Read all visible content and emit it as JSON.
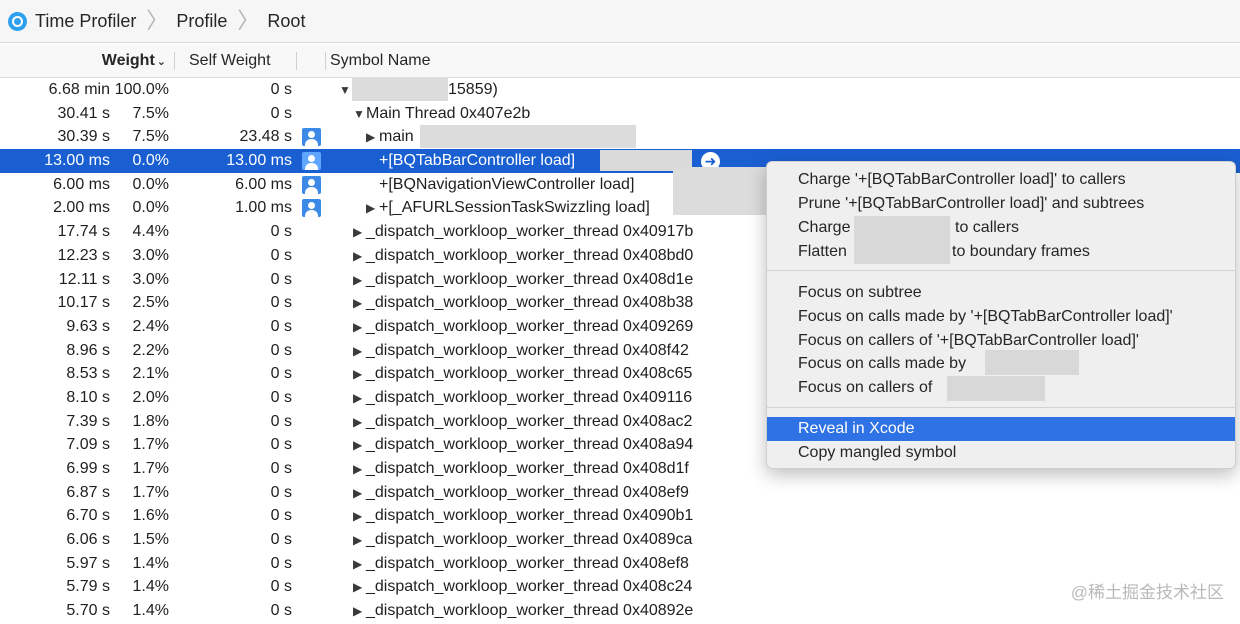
{
  "breadcrumb": {
    "items": [
      "Time Profiler",
      "Profile",
      "Root"
    ],
    "separator": "〉"
  },
  "columns": {
    "weight": "Weight",
    "self_weight": "Self Weight",
    "symbol_name": "Symbol Name",
    "sort_indicator": "⌄"
  },
  "rows": [
    {
      "weight": "6.68 min",
      "percent": "100.0%",
      "self": "0 s",
      "symbol": "15859)",
      "triangle": "▼"
    },
    {
      "weight": "30.41 s",
      "percent": "7.5%",
      "self": "0 s",
      "symbol": "Main Thread  0x407e2b",
      "triangle": "▼"
    },
    {
      "weight": "30.39 s",
      "percent": "7.5%",
      "self": "23.48 s",
      "symbol": "main",
      "triangle": "▶"
    },
    {
      "weight": "13.00 ms",
      "percent": "0.0%",
      "self": "13.00 ms",
      "symbol": "+[BQTabBarController load]",
      "triangle": ""
    },
    {
      "weight": "6.00 ms",
      "percent": "0.0%",
      "self": "6.00 ms",
      "symbol": "+[BQNavigationViewController load]",
      "triangle": ""
    },
    {
      "weight": "2.00 ms",
      "percent": "0.0%",
      "self": "1.00 ms",
      "symbol": "+[_AFURLSessionTaskSwizzling load]",
      "triangle": "▶"
    },
    {
      "weight": "17.74 s",
      "percent": "4.4%",
      "self": "0 s",
      "symbol": "_dispatch_workloop_worker_thread  0x40917b",
      "triangle": "▶"
    },
    {
      "weight": "12.23 s",
      "percent": "3.0%",
      "self": "0 s",
      "symbol": "_dispatch_workloop_worker_thread  0x408bd0",
      "triangle": "▶"
    },
    {
      "weight": "12.11 s",
      "percent": "3.0%",
      "self": "0 s",
      "symbol": "_dispatch_workloop_worker_thread  0x408d1e",
      "triangle": "▶"
    },
    {
      "weight": "10.17 s",
      "percent": "2.5%",
      "self": "0 s",
      "symbol": "_dispatch_workloop_worker_thread  0x408b38",
      "triangle": "▶"
    },
    {
      "weight": "9.63 s",
      "percent": "2.4%",
      "self": "0 s",
      "symbol": "_dispatch_workloop_worker_thread  0x409269",
      "triangle": "▶"
    },
    {
      "weight": "8.96 s",
      "percent": "2.2%",
      "self": "0 s",
      "symbol": "_dispatch_workloop_worker_thread  0x408f42",
      "triangle": "▶"
    },
    {
      "weight": "8.53 s",
      "percent": "2.1%",
      "self": "0 s",
      "symbol": "_dispatch_workloop_worker_thread  0x408c65",
      "triangle": "▶"
    },
    {
      "weight": "8.10 s",
      "percent": "2.0%",
      "self": "0 s",
      "symbol": "_dispatch_workloop_worker_thread  0x409116",
      "triangle": "▶"
    },
    {
      "weight": "7.39 s",
      "percent": "1.8%",
      "self": "0 s",
      "symbol": "_dispatch_workloop_worker_thread  0x408ac2",
      "triangle": "▶"
    },
    {
      "weight": "7.09 s",
      "percent": "1.7%",
      "self": "0 s",
      "symbol": "_dispatch_workloop_worker_thread  0x408a94",
      "triangle": "▶"
    },
    {
      "weight": "6.99 s",
      "percent": "1.7%",
      "self": "0 s",
      "symbol": "_dispatch_workloop_worker_thread  0x408d1f",
      "triangle": "▶"
    },
    {
      "weight": "6.87 s",
      "percent": "1.7%",
      "self": "0 s",
      "symbol": "_dispatch_workloop_worker_thread  0x408ef9",
      "triangle": "▶"
    },
    {
      "weight": "6.70 s",
      "percent": "1.6%",
      "self": "0 s",
      "symbol": "_dispatch_workloop_worker_thread  0x4090b1",
      "triangle": "▶"
    },
    {
      "weight": "6.06 s",
      "percent": "1.5%",
      "self": "0 s",
      "symbol": "_dispatch_workloop_worker_thread  0x4089ca",
      "triangle": "▶"
    },
    {
      "weight": "5.97 s",
      "percent": "1.4%",
      "self": "0 s",
      "symbol": "_dispatch_workloop_worker_thread  0x408ef8",
      "triangle": "▶"
    },
    {
      "weight": "5.79 s",
      "percent": "1.4%",
      "self": "0 s",
      "symbol": "_dispatch_workloop_worker_thread  0x408c24",
      "triangle": "▶"
    },
    {
      "weight": "5.70 s",
      "percent": "1.4%",
      "self": "0 s",
      "symbol": "_dispatch_workloop_worker_thread  0x40892e",
      "triangle": "▶"
    }
  ],
  "context_menu": {
    "items": [
      "Charge '+[BQTabBarController load]' to callers",
      "Prune '+[BQTabBarController load]' and subtrees",
      "Charge",
      "Flatten",
      "Focus on subtree",
      "Focus on calls made by '+[BQTabBarController load]'",
      "Focus on callers of '+[BQTabBarController load]'",
      "Focus on calls made by",
      "Focus on callers of",
      "Reveal in Xcode",
      "Copy mangled symbol"
    ],
    "charge_suffix": "to callers",
    "flatten_suffix": "to boundary frames",
    "highlighted": "Reveal in Xcode"
  },
  "watermark": "@稀土掘金技术社区",
  "colors": {
    "selection": "#1a5fd2",
    "menu_highlight": "#2f72e5",
    "user_code_icon": "#3d8ae6"
  },
  "icons": {
    "breadcrumb": "time-profiler-icon",
    "user_code": "person-icon",
    "reveal": "arrow-circle-icon"
  }
}
